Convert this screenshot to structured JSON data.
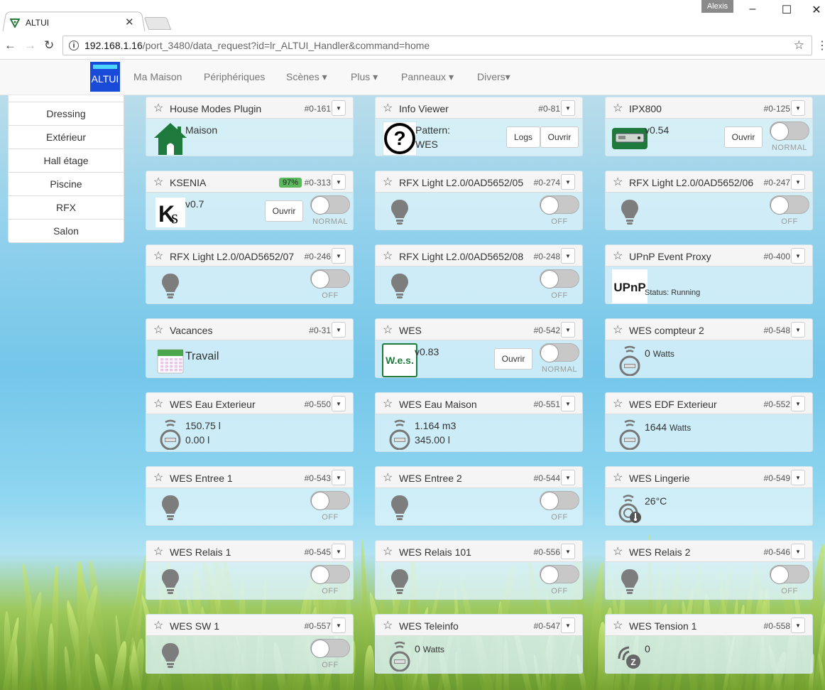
{
  "browser": {
    "tab_title": "ALTUI",
    "user_badge": "Alexis",
    "url_host": "192.168.1.16",
    "url_path": "/port_3480/data_request?id=lr_ALTUI_Handler&command=home"
  },
  "navbar": {
    "brand": "ALTUI",
    "items": [
      "Ma Maison",
      "Périphériques",
      "Scènes ▾",
      "Plus ▾",
      "Panneaux ▾",
      "Divers▾"
    ]
  },
  "sidebar": {
    "items": [
      "Dressing",
      "Extérieur",
      "Hall étage",
      "Piscine",
      "RFX",
      "Salon"
    ]
  },
  "devices": [
    {
      "name": "House Modes Plugin",
      "id": "#0-161",
      "line1": "Maison",
      "icon": "house-icon"
    },
    {
      "name": "Info Viewer",
      "id": "#0-81",
      "line1": "Pattern:",
      "line2": "WES",
      "btn1": "Logs",
      "btn2": "Ouvrir",
      "icon": "question-icon"
    },
    {
      "name": "IPX800",
      "id": "#0-125",
      "line1": "v0.54",
      "btn1": "Ouvrir",
      "toggle": "NORMAL",
      "icon": "ipx800-icon"
    },
    {
      "name": "KSENIA",
      "id": "#0-313",
      "battery": "97%",
      "line1": "v0.7",
      "btn1": "Ouvrir",
      "toggle": "NORMAL",
      "icon": "ksenia-logo-icon"
    },
    {
      "name": "RFX Light L2.0/0AD5652/05",
      "id": "#0-274",
      "toggle": "OFF",
      "icon": "bulb-icon"
    },
    {
      "name": "RFX Light L2.0/0AD5652/06",
      "id": "#0-247",
      "toggle": "OFF",
      "icon": "bulb-icon"
    },
    {
      "name": "RFX Light L2.0/0AD5652/07",
      "id": "#0-246",
      "toggle": "OFF",
      "icon": "bulb-icon"
    },
    {
      "name": "RFX Light L2.0/0AD5652/08",
      "id": "#0-248",
      "toggle": "OFF",
      "icon": "bulb-icon"
    },
    {
      "name": "UPnP Event Proxy",
      "id": "#0-400",
      "line1": "Status: Running",
      "icon": "upnp-logo-icon"
    },
    {
      "name": "Vacances",
      "id": "#0-31",
      "line1": "Travail",
      "icon": "calendar-icon"
    },
    {
      "name": "WES",
      "id": "#0-542",
      "line1": "v0.83",
      "btn1": "Ouvrir",
      "toggle": "NORMAL",
      "icon": "wes-logo-icon"
    },
    {
      "name": "WES compteur 2",
      "id": "#0-548",
      "line1": "0",
      "unit1": "Watts",
      "icon": "meter-icon"
    },
    {
      "name": "WES Eau Exterieur",
      "id": "#0-550",
      "line1": "150.75 l",
      "line2": "0.00 l",
      "icon": "meter-icon"
    },
    {
      "name": "WES Eau Maison",
      "id": "#0-551",
      "line1": "1.164 m3",
      "line2": "345.00 l",
      "icon": "meter-icon"
    },
    {
      "name": "WES EDF Exterieur",
      "id": "#0-552",
      "line1": "1644",
      "unit1": "Watts",
      "icon": "meter-icon"
    },
    {
      "name": "WES Entree 1",
      "id": "#0-543",
      "toggle": "OFF",
      "icon": "bulb-icon"
    },
    {
      "name": "WES Entree 2",
      "id": "#0-544",
      "toggle": "OFF",
      "icon": "bulb-icon"
    },
    {
      "name": "WES Lingerie",
      "id": "#0-549",
      "line1": "26°C",
      "icon": "thermometer-sensor-icon"
    },
    {
      "name": "WES Relais 1",
      "id": "#0-545",
      "toggle": "OFF",
      "icon": "bulb-icon"
    },
    {
      "name": "WES Relais 101",
      "id": "#0-556",
      "toggle": "OFF",
      "icon": "bulb-icon"
    },
    {
      "name": "WES Relais 2",
      "id": "#0-546",
      "toggle": "OFF",
      "icon": "bulb-icon"
    },
    {
      "name": "WES SW 1",
      "id": "#0-557",
      "toggle": "OFF",
      "icon": "bulb-icon"
    },
    {
      "name": "WES Teleinfo",
      "id": "#0-547",
      "line1": "0",
      "unit1": "Watts",
      "icon": "meter-icon"
    },
    {
      "name": "WES Tension 1",
      "id": "#0-558",
      "line1": "0",
      "icon": "zwave-sensor-icon"
    }
  ]
}
